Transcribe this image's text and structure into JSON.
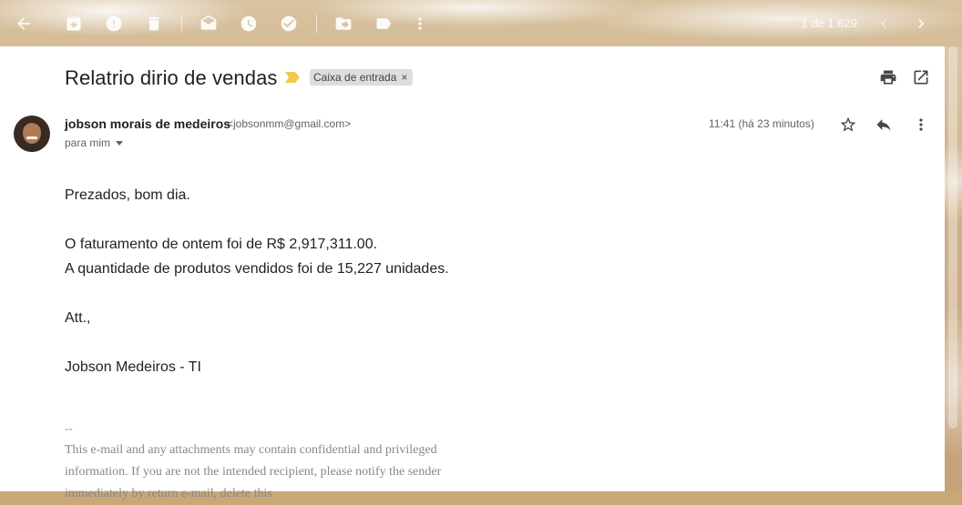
{
  "toolbar": {
    "icons": [
      "back-arrow-icon",
      "archive-icon",
      "report-spam-icon",
      "delete-icon",
      "mark-unread-icon",
      "snooze-icon",
      "add-task-icon",
      "move-to-icon",
      "label-icon",
      "more-vert-icon"
    ],
    "pager_text": "1 de 1.629"
  },
  "email": {
    "subject": "Relatrio dirio de vendas",
    "label": "Caixa de entrada",
    "label_remove": "×",
    "sender_name": "jobson morais de medeiros",
    "sender_email": "<jobsonmm@gmail.com>",
    "to": "para mim",
    "time": "11:41 (há 23 minutos)",
    "body": {
      "greeting": "Prezados, bom dia.",
      "line1": "O faturamento de ontem foi de R$ 2,917,311.00.",
      "line2": "A quantidade de produtos vendidos foi de 15,227 unidades.",
      "closing": "Att.,",
      "signature": "Jobson Medeiros - TI"
    },
    "sig_separator": "--",
    "disclaimer": "This e-mail and any attachments may contain confidential and privileged information. If you are not the intended recipient, please notify the sender immediately by return e-mail, delete this"
  },
  "colors": {
    "important_marker": "#f2c94c",
    "card_bg": "#ffffff"
  }
}
